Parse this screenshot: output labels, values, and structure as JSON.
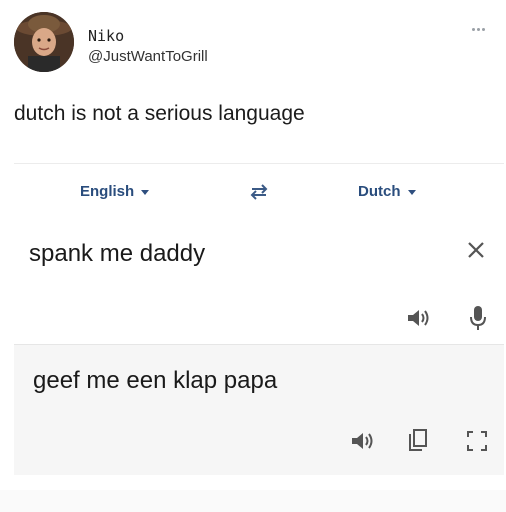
{
  "tweet": {
    "author_name": "Niko",
    "author_handle": "@JustWantToGrill",
    "text": "dutch is not a serious language",
    "more_icon": "more-dots-icon"
  },
  "translate": {
    "source_language": "English",
    "target_language": "Dutch",
    "source_text": "spank me daddy",
    "translated_text": "geef me een klap papa",
    "icons": [
      "swap-arrows-icon",
      "close-icon",
      "speaker-icon",
      "microphone-icon",
      "copy-icon",
      "expand-icon"
    ],
    "accent_color": "#2a4d7d"
  }
}
